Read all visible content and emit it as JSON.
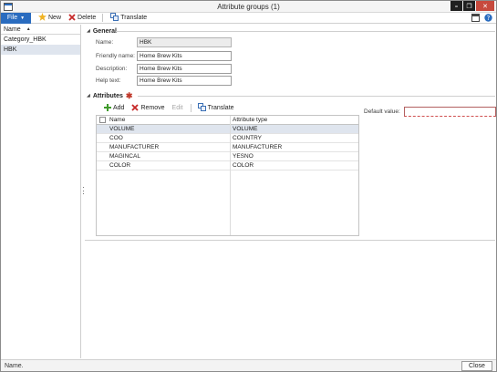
{
  "window": {
    "title": "Attribute groups (1)",
    "controls": {
      "minimize": "–",
      "restore": "❐",
      "close": "✕"
    }
  },
  "toolbar": {
    "file_label": "File",
    "new_label": "New",
    "delete_label": "Delete",
    "translate_label": "Translate"
  },
  "list": {
    "header": "Name",
    "items": [
      {
        "label": "Category_HBK",
        "selected": false
      },
      {
        "label": "HBK",
        "selected": true
      }
    ]
  },
  "general": {
    "title": "General",
    "name_label": "Name:",
    "name_value": "HBK",
    "friendly_label": "Friendly name:",
    "friendly_value": "Home Brew Kits",
    "description_label": "Description:",
    "description_value": "Home Brew Kits",
    "help_label": "Help text:",
    "help_value": "Home Brew Kits"
  },
  "attributes": {
    "title": "Attributes",
    "add_label": "Add",
    "remove_label": "Remove",
    "edit_label": "Edit",
    "translate_label": "Translate",
    "columns": {
      "name": "Name",
      "type": "Attribute type"
    },
    "rows": [
      {
        "name": "VOLUME",
        "type": "VOLUME"
      },
      {
        "name": "COO",
        "type": "COUNTRY"
      },
      {
        "name": "MANUFACTURER",
        "type": "MANUFACTURER"
      },
      {
        "name": "MAGINCAL",
        "type": "YESNO"
      },
      {
        "name": "COLOR",
        "type": "COLOR"
      }
    ],
    "default_value_label": "Default value:",
    "default_value": ""
  },
  "status": {
    "text": "Name.",
    "close_label": "Close"
  },
  "colors": {
    "file_button": "#2a6cbf",
    "selected_row": "#dfe5ee",
    "required": "#c0392b",
    "close_window": "#c74a3d"
  }
}
